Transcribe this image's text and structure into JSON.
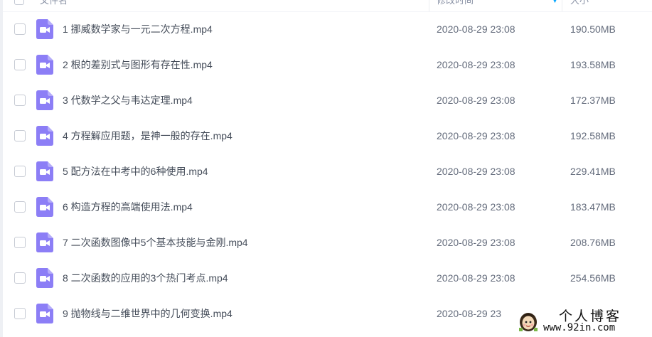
{
  "header": {
    "name_label": "文件名",
    "modified_label": "修改时间",
    "size_label": "大小"
  },
  "colors": {
    "accent": "#06a7ff",
    "video_icon": "#8c7ef6"
  },
  "files": [
    {
      "name": "1 挪威数学家与一元二次方程.mp4",
      "modified": "2020-08-29 23:08",
      "size": "190.50MB",
      "icon": "video-file-icon"
    },
    {
      "name": "2 根的差别式与图形有存在性.mp4",
      "modified": "2020-08-29 23:08",
      "size": "193.58MB",
      "icon": "video-file-icon"
    },
    {
      "name": "3 代数学之父与韦达定理.mp4",
      "modified": "2020-08-29 23:08",
      "size": "172.37MB",
      "icon": "video-file-icon"
    },
    {
      "name": "4 方程解应用题，是神一般的存在.mp4",
      "modified": "2020-08-29 23:08",
      "size": "192.58MB",
      "icon": "video-file-icon"
    },
    {
      "name": "5 配方法在中考中的6种使用.mp4",
      "modified": "2020-08-29 23:08",
      "size": "229.41MB",
      "icon": "video-file-icon"
    },
    {
      "name": "6 构造方程的高端使用法.mp4",
      "modified": "2020-08-29 23:08",
      "size": "183.47MB",
      "icon": "video-file-icon"
    },
    {
      "name": "7 二次函数图像中5个基本技能与金刚.mp4",
      "modified": "2020-08-29 23:08",
      "size": "208.76MB",
      "icon": "video-file-icon"
    },
    {
      "name": "8 二次函数的应用的3个热门考点.mp4",
      "modified": "2020-08-29 23:08",
      "size": "254.56MB",
      "icon": "video-file-icon"
    },
    {
      "name": "9 抛物线与二维世界中的几何变换.mp4",
      "modified": "2020-08-29 23",
      "size": "",
      "icon": "video-file-icon"
    }
  ],
  "watermark": {
    "title": "个人博客",
    "url": "www.92in.com"
  }
}
